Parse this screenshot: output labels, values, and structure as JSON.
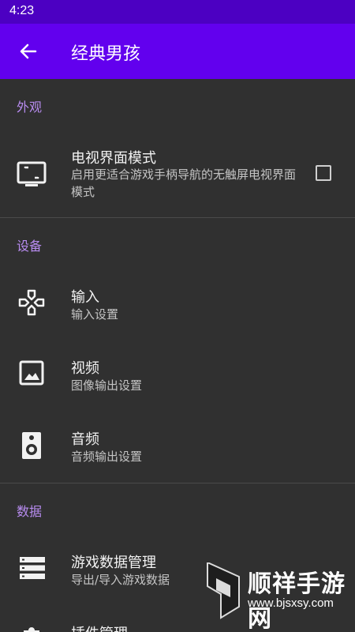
{
  "status_bar": {
    "time": "4:23"
  },
  "app_bar": {
    "title": "经典男孩",
    "back_icon": "arrow-back-icon"
  },
  "sections": {
    "appearance": {
      "header": "外观"
    },
    "devices": {
      "header": "设备"
    },
    "data": {
      "header": "数据"
    }
  },
  "items": {
    "tv_mode": {
      "title": "电视界面模式",
      "subtitle": "启用更适合游戏手柄导航的无触屏电视界面模式",
      "icon": "tv-icon",
      "checked": false
    },
    "input": {
      "title": "输入",
      "subtitle": "输入设置",
      "icon": "gamepad-icon"
    },
    "video": {
      "title": "视频",
      "subtitle": "图像输出设置",
      "icon": "image-icon"
    },
    "audio": {
      "title": "音频",
      "subtitle": "音频输出设置",
      "icon": "speaker-icon"
    },
    "game_data": {
      "title": "游戏数据管理",
      "subtitle": "导出/导入游戏数据",
      "icon": "storage-icon"
    },
    "plugins": {
      "title": "插件管理",
      "icon": "puzzle-icon"
    }
  },
  "watermark": {
    "name": "顺祥手游网",
    "url": "www.bjsxsy.com"
  },
  "colors": {
    "status_bar": "#4c00c2",
    "app_bar": "#6200ee",
    "background": "#303030",
    "accent": "#b88cf0"
  }
}
